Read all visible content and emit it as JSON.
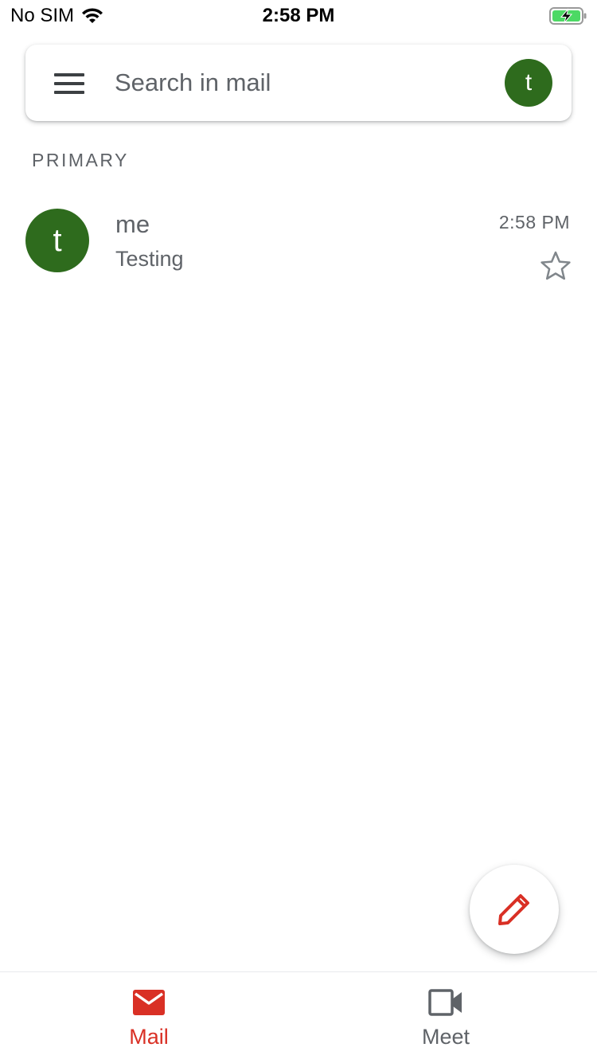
{
  "status_bar": {
    "carrier": "No SIM",
    "time": "2:58 PM"
  },
  "search": {
    "placeholder": "Search in mail",
    "account_initial": "t"
  },
  "section": {
    "label": "PRIMARY"
  },
  "emails": [
    {
      "avatar_initial": "t",
      "sender": "me",
      "subject": "Testing",
      "time": "2:58 PM",
      "starred": false
    }
  ],
  "bottom_nav": {
    "items": [
      {
        "label": "Mail",
        "icon": "mail-icon",
        "active": true
      },
      {
        "label": "Meet",
        "icon": "video-camera-icon",
        "active": false
      }
    ]
  },
  "colors": {
    "avatar": "#2e6b1d",
    "accent_red": "#d93025",
    "battery_green": "#4cd964"
  }
}
